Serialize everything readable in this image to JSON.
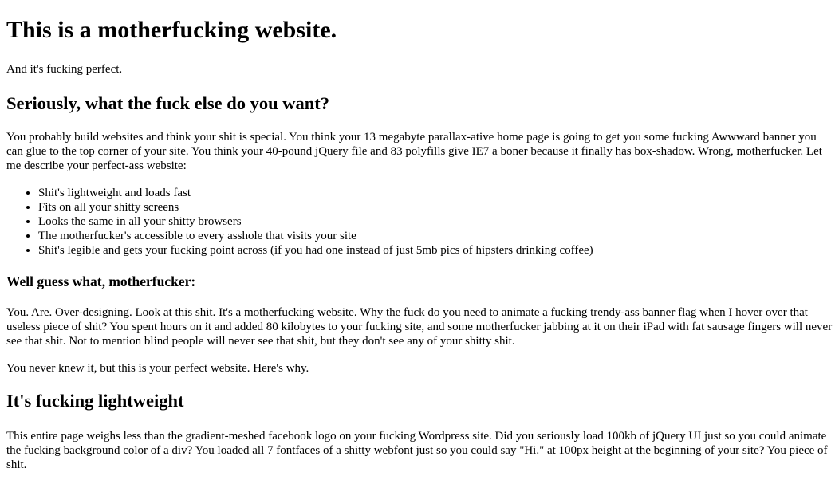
{
  "page": {
    "title": "This is a motherfucking website.",
    "tagline": "And it's fucking perfect."
  },
  "section_want": {
    "heading": "Seriously, what the fuck else do you want?",
    "paragraph": "You probably build websites and think your shit is special. You think your 13 megabyte parallax-ative home page is going to get you some fucking Awwward banner you can glue to the top corner of your site. You think your 40-pound jQuery file and 83 polyfills give IE7 a boner because it finally has box-shadow. Wrong, motherfucker. Let me describe your perfect-ass website:",
    "items": [
      "Shit's lightweight and loads fast",
      "Fits on all your shitty screens",
      "Looks the same in all your shitty browsers",
      "The motherfucker's accessible to every asshole that visits your site",
      "Shit's legible and gets your fucking point across (if you had one instead of just 5mb pics of hipsters drinking coffee)"
    ]
  },
  "section_guess": {
    "heading": "Well guess what, motherfucker:",
    "paragraph1": "You. Are. Over-designing. Look at this shit. It's a motherfucking website. Why the fuck do you need to animate a fucking trendy-ass banner flag when I hover over that useless piece of shit? You spent hours on it and added 80 kilobytes to your fucking site, and some motherfucker jabbing at it on their iPad with fat sausage fingers will never see that shit. Not to mention blind people will never see that shit, but they don't see any of your shitty shit.",
    "paragraph2": "You never knew it, but this is your perfect website. Here's why."
  },
  "section_lightweight": {
    "heading": "It's fucking lightweight",
    "paragraph": "This entire page weighs less than the gradient-meshed facebook logo on your fucking Wordpress site. Did you seriously load 100kb of jQuery UI just so you could animate the fucking background color of a div? You loaded all 7 fontfaces of a shitty webfont just so you could say \"Hi.\" at 100px height at the beginning of your site? You piece of shit."
  }
}
